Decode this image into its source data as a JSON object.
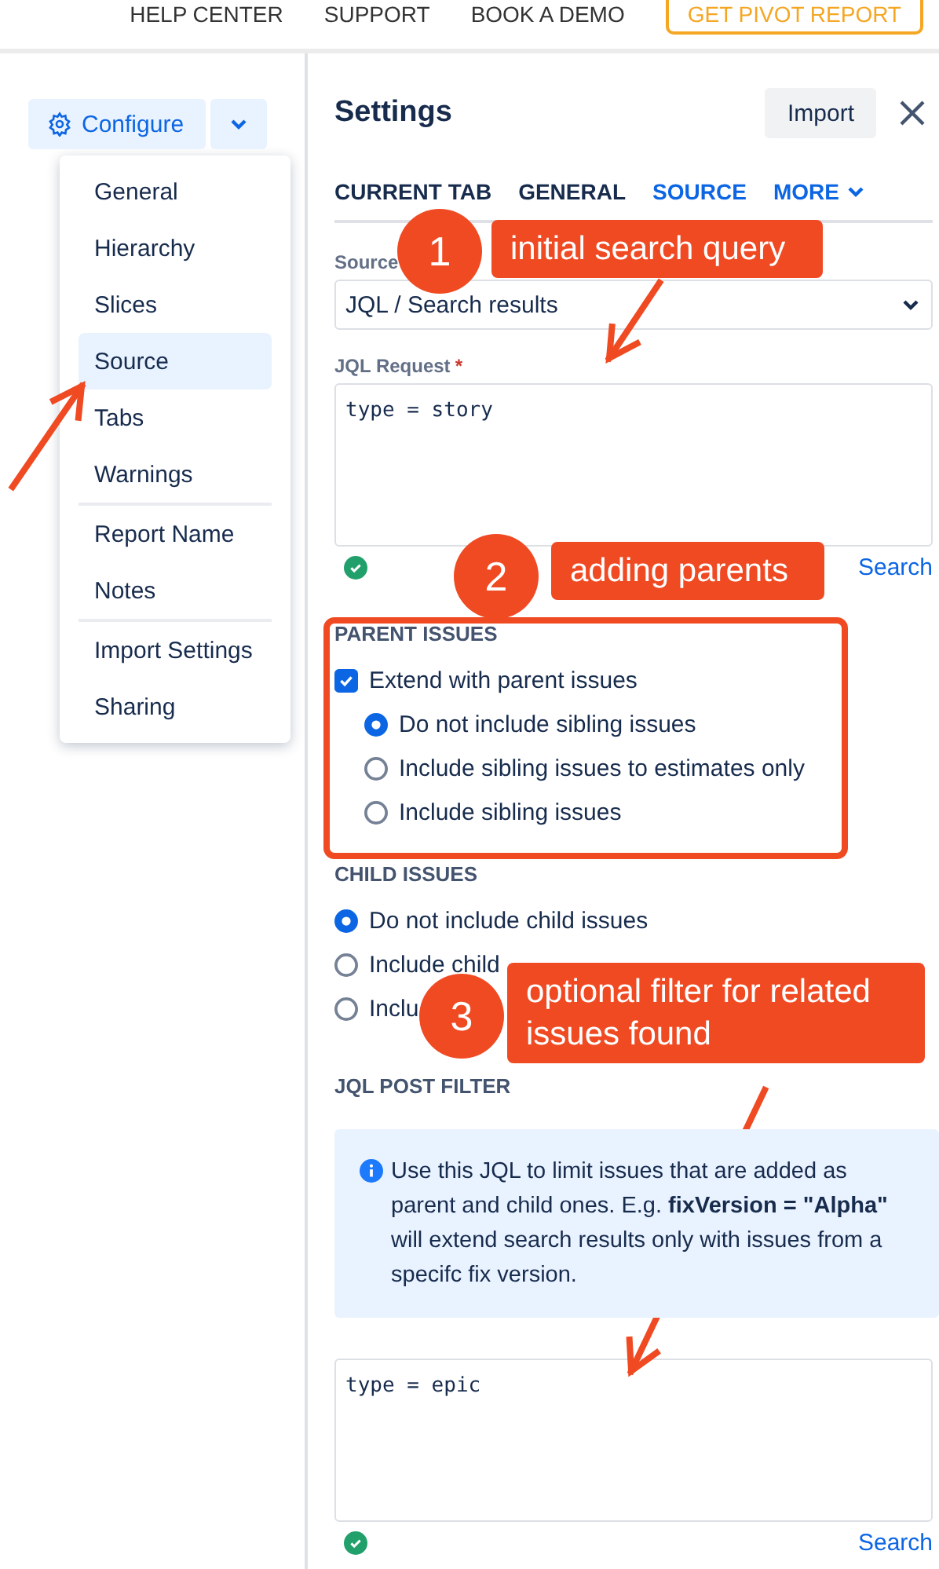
{
  "top_nav": {
    "links": [
      "HELP CENTER",
      "SUPPORT",
      "BOOK A DEMO"
    ],
    "cta": "GET PIVOT REPORT"
  },
  "toolbar": {
    "configure": "Configure"
  },
  "configure_menu": {
    "groups": [
      [
        {
          "label": "General",
          "selected": false
        },
        {
          "label": "Hierarchy",
          "selected": false
        },
        {
          "label": "Slices",
          "selected": false
        },
        {
          "label": "Source",
          "selected": true
        },
        {
          "label": "Tabs",
          "selected": false
        },
        {
          "label": "Warnings",
          "selected": false
        }
      ],
      [
        {
          "label": "Report Name",
          "selected": false
        },
        {
          "label": "Notes",
          "selected": false
        }
      ],
      [
        {
          "label": "Import Settings",
          "selected": false
        },
        {
          "label": "Sharing",
          "selected": false
        }
      ]
    ]
  },
  "settings": {
    "title": "Settings",
    "import_button": "Import",
    "tabs": [
      {
        "label": "CURRENT TAB",
        "selected": false
      },
      {
        "label": "GENERAL",
        "selected": false
      },
      {
        "label": "SOURCE",
        "selected": true
      }
    ],
    "more_tab": "MORE",
    "source_label": "Source",
    "source_value": "JQL / Search results",
    "jql_label": "JQL Request",
    "jql_required_mark": "*",
    "jql_value": "type = story",
    "jql_valid": true,
    "search_link": "Search",
    "parent_issues": {
      "heading": "PARENT ISSUES",
      "extend": {
        "label": "Extend with parent issues",
        "checked": true
      },
      "options": [
        {
          "label": "Do not include sibling issues",
          "selected": true
        },
        {
          "label": "Include sibling issues to estimates only",
          "selected": false
        },
        {
          "label": "Include sibling issues",
          "selected": false
        }
      ]
    },
    "child_issues": {
      "heading": "CHILD ISSUES",
      "options": [
        {
          "label": "Do not include child issues",
          "selected": true
        },
        {
          "label": "Include child",
          "selected": false
        },
        {
          "label": "Inclu",
          "selected": false
        }
      ]
    },
    "post_filter": {
      "heading": "JQL POST FILTER",
      "info": "Use this JQL to limit issues that are added as parent and child ones. E.g. **fixVersion = \"Alpha\"** will extend search results only with issues from a specifc fix version.",
      "value": "type = epic",
      "valid": true,
      "search_link": "Search"
    }
  },
  "annotations": [
    {
      "number": "1",
      "text": "initial search query"
    },
    {
      "number": "2",
      "text": "adding parents"
    },
    {
      "number": "3",
      "text": "optional filter for related issues found"
    }
  ]
}
